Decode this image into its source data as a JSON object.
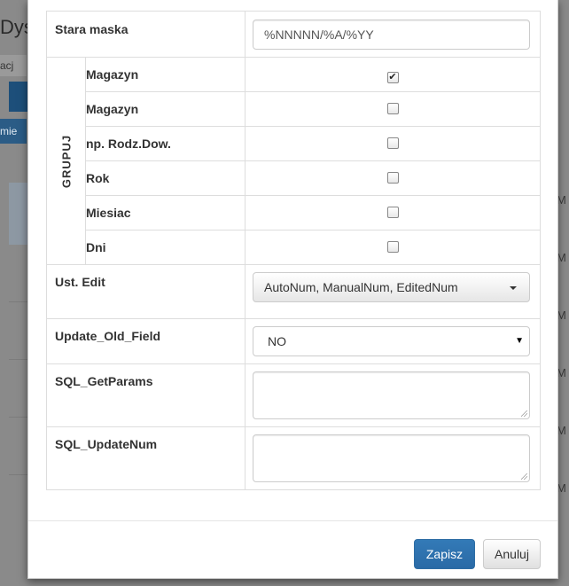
{
  "background": {
    "title_fragment": "Dys",
    "tab_fragment": "acj",
    "bar_fragment": "mie",
    "right_marks": [
      "M",
      "M",
      "M",
      "M",
      "M",
      "M",
      "M",
      "M"
    ]
  },
  "form": {
    "stara_maska": {
      "label": "Stara maska",
      "value": "%NNNNN/%A/%YY"
    },
    "grupuj": {
      "label": "GRUPUJ",
      "rows": [
        {
          "label": "Magazyn",
          "checked": true
        },
        {
          "label": "Magazyn",
          "checked": false
        },
        {
          "label": "np. Rodz.Dow.",
          "checked": false
        },
        {
          "label": "Rok",
          "checked": false
        },
        {
          "label": "Miesiac",
          "checked": false
        },
        {
          "label": "Dni",
          "checked": false
        }
      ]
    },
    "ust_edit": {
      "label": "Ust. Edit",
      "value": "AutoNum, ManualNum, EditedNum"
    },
    "update_old_field": {
      "label": "Update_Old_Field",
      "value": "NO"
    },
    "sql_getparams": {
      "label": "SQL_GetParams",
      "value": ""
    },
    "sql_updatenum": {
      "label": "SQL_UpdateNum",
      "value": ""
    }
  },
  "footer": {
    "save_label": "Zapisz",
    "cancel_label": "Anuluj"
  },
  "colors": {
    "primary": "#337ab7",
    "overlay": "#8a8a8a"
  },
  "icons": {
    "checkbox_checked": "check-icon",
    "dropdown": "caret-down-icon"
  }
}
